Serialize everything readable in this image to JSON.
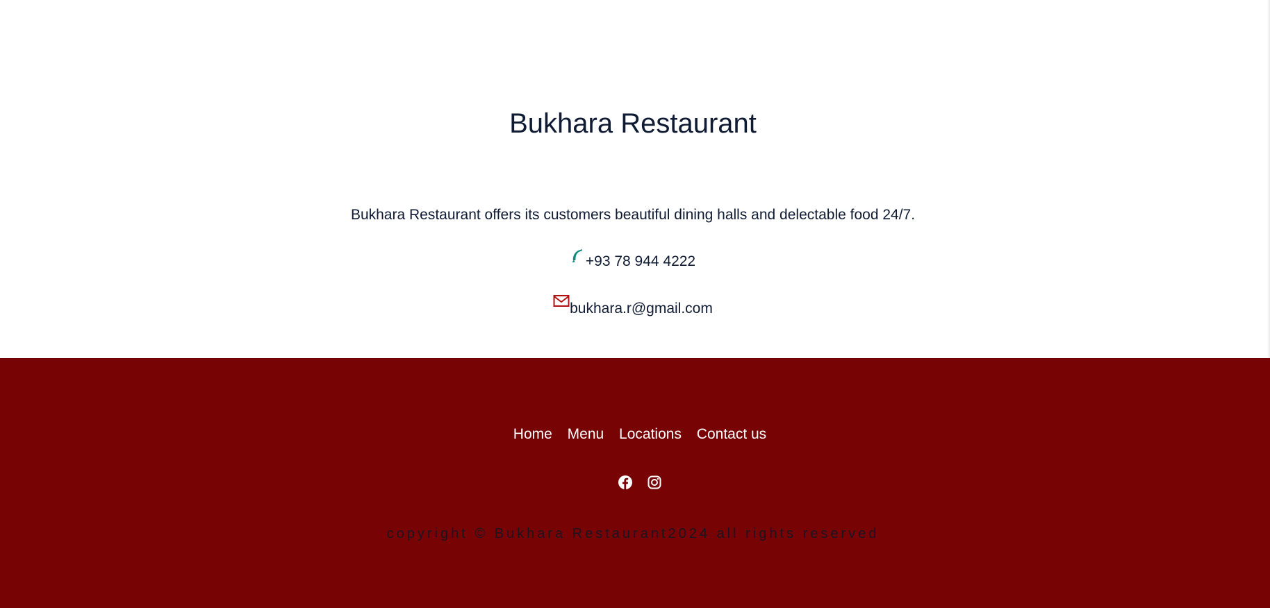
{
  "main": {
    "title": "Bukhara Restaurant",
    "description": "Bukhara Restaurant offers its customers beautiful dining halls and delectable food 24/7.",
    "phone": {
      "icon": "phone-icon",
      "icon_color": "#0f8a7a",
      "text": "+93 78 944 4222"
    },
    "email": {
      "icon": "mail-icon",
      "icon_color": "#b01010",
      "text": "bukhara.r@gmail.com"
    }
  },
  "footer": {
    "background_color": "#780305",
    "nav": [
      {
        "label": "Home"
      },
      {
        "label": "Menu"
      },
      {
        "label": "Locations"
      },
      {
        "label": "Contact us"
      }
    ],
    "social": [
      {
        "icon": "facebook-icon"
      },
      {
        "icon": "instagram-icon"
      }
    ],
    "copyright": "copyright © Bukhara Restaurant2024 all rights reserved"
  }
}
